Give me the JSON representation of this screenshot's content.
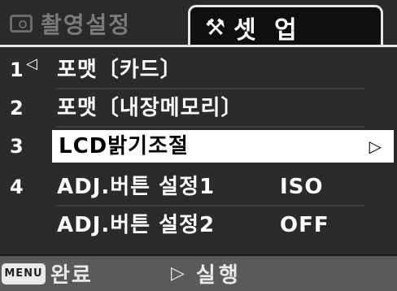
{
  "tabs": {
    "inactive": {
      "label": "촬영설정",
      "icon": "camera-icon"
    },
    "active": {
      "label": "셋 업",
      "icon_glyph": "⚒",
      "icon": "tools-icon"
    }
  },
  "menu": {
    "items": [
      {
        "num": "1",
        "label": "포맷〔카드〕",
        "value": "",
        "selected": false
      },
      {
        "num": "2",
        "label": "포맷〔내장메모리〕",
        "value": "",
        "selected": false
      },
      {
        "num": "3",
        "label": "LCD밝기조절",
        "value": "",
        "selected": true,
        "right_arrow": "▷"
      },
      {
        "num": "4",
        "label": "ADJ.버튼 설정1",
        "value": "ISO",
        "selected": false
      },
      {
        "num": "",
        "label": "ADJ.버튼 설정2",
        "value": "OFF",
        "selected": false
      }
    ],
    "left_arrow": "◁"
  },
  "bottom": {
    "menu_button": "MENU",
    "done_label": "완료",
    "exec_icon": "▷",
    "exec_label": "실행"
  }
}
